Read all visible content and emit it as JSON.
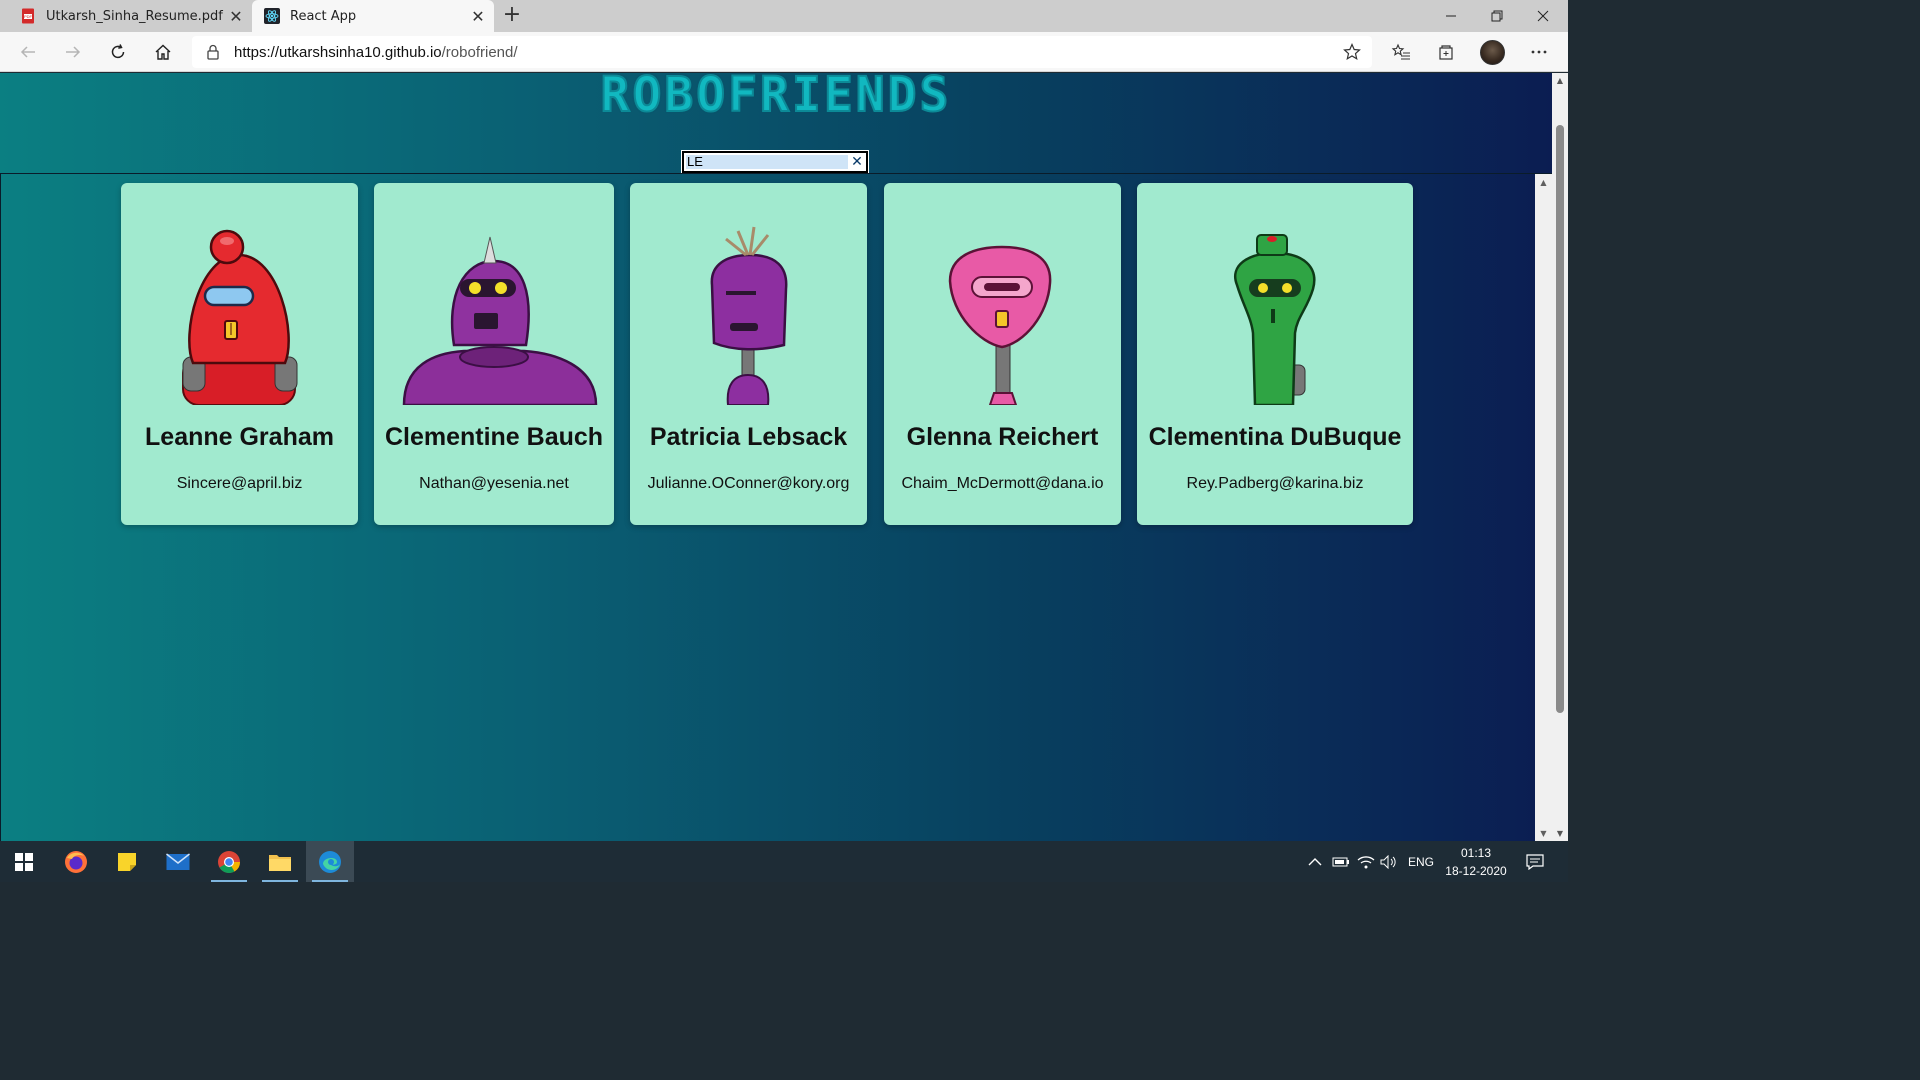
{
  "browser": {
    "tabs": [
      {
        "title": "Utkarsh_Sinha_Resume.pdf",
        "icon": "pdf-icon",
        "active": false
      },
      {
        "title": "React App",
        "icon": "react-icon",
        "active": true
      }
    ],
    "url": {
      "host": "https://utkarshsinha10.github.io",
      "path": "/robofriend/"
    }
  },
  "app": {
    "logo": "ROBOFRIENDS",
    "search": {
      "value": "LE",
      "clear_label": "✕"
    },
    "robots": [
      {
        "name": "Leanne Graham",
        "email": "Sincere@april.biz",
        "color": "#e52a2f"
      },
      {
        "name": "Clementine Bauch",
        "email": "Nathan@yesenia.net",
        "color": "#8c2f9a"
      },
      {
        "name": "Patricia Lebsack",
        "email": "Julianne.OConner@kory.org",
        "color": "#8d2fa0"
      },
      {
        "name": "Glenna Reichert",
        "email": "Chaim_McDermott@dana.io",
        "color": "#e85aa6"
      },
      {
        "name": "Clementina DuBuque",
        "email": "Rey.Padberg@karina.biz",
        "color": "#2fa444"
      }
    ]
  },
  "taskbar": {
    "lang": "ENG",
    "time": "01:13",
    "date": "18-12-2020"
  }
}
